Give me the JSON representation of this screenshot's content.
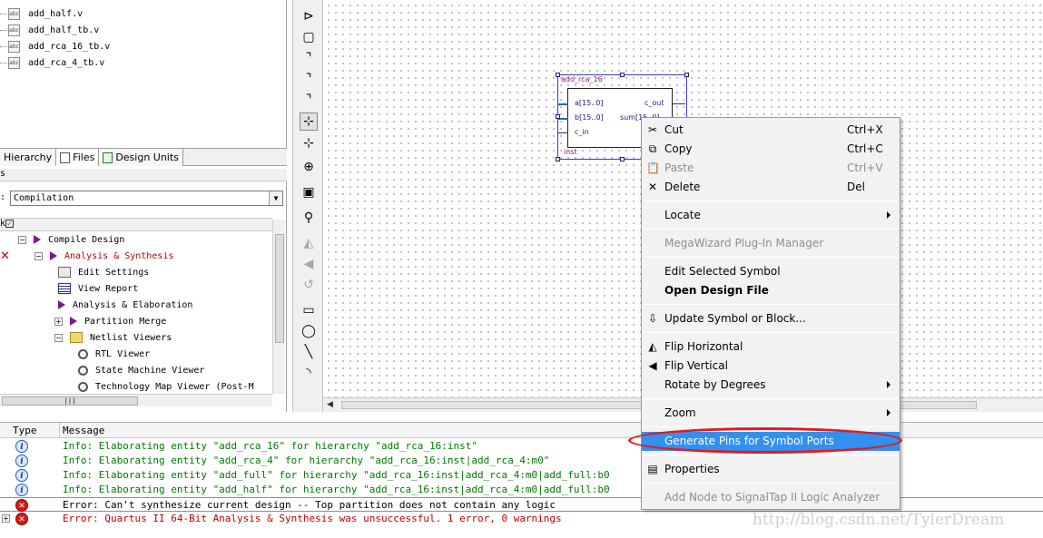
{
  "files": [
    {
      "name": "add_half.v"
    },
    {
      "name": "add_half_tb.v"
    },
    {
      "name": "add_rca_16_tb.v"
    },
    {
      "name": "add_rca_4_tb.v"
    }
  ],
  "file_icon_text": "abc",
  "nav_tabs": [
    {
      "label": "Hierarchy",
      "icon": "hierarchy-icon"
    },
    {
      "label": "Files",
      "icon": "file-icon"
    },
    {
      "label": "Design Units",
      "icon": "design-units-icon"
    }
  ],
  "tasks": {
    "header": "s",
    "flow_label": ":",
    "flow_value": "Compilation",
    "task_col": "k",
    "items": [
      {
        "label": "Compile Design",
        "icon": "play-icon",
        "expander": "−",
        "error": false
      },
      {
        "label": "Analysis & Synthesis",
        "icon": "play-icon",
        "expander": "−",
        "error": true
      },
      {
        "label": "Edit Settings",
        "icon": "settings-icon",
        "expander": "",
        "error": false
      },
      {
        "label": "View Report",
        "icon": "report-icon",
        "expander": "",
        "error": false
      },
      {
        "label": "Analysis & Elaboration",
        "icon": "play-icon",
        "expander": "",
        "error": false
      },
      {
        "label": "Partition Merge",
        "icon": "play-icon",
        "expander": "+",
        "error": false
      },
      {
        "label": "Netlist Viewers",
        "icon": "folder-icon",
        "expander": "−",
        "error": false
      },
      {
        "label": "RTL Viewer",
        "icon": "viewer-icon",
        "expander": "",
        "error": false
      },
      {
        "label": "State Machine Viewer",
        "icon": "viewer-icon",
        "expander": "",
        "error": false
      },
      {
        "label": "Technology Map Viewer (Post-M",
        "icon": "viewer-icon",
        "expander": "",
        "error": false
      }
    ]
  },
  "symbol": {
    "name": "add_rca_16",
    "inst": "inst",
    "ports_in": [
      "a[15..0]",
      "b[15..0]",
      "c_in"
    ],
    "ports_out": [
      "c_out",
      "sum[15..0]"
    ]
  },
  "messages": {
    "col_type": "Type",
    "col_message": "Message",
    "rows": [
      {
        "kind": "info",
        "text": "Info: Elaborating entity \"add_rca_16\" for hierarchy \"add_rca_16:inst\""
      },
      {
        "kind": "info",
        "text": "Info: Elaborating entity \"add_rca_4\" for hierarchy \"add_rca_16:inst|add_rca_4:m0\""
      },
      {
        "kind": "info",
        "text": "Info: Elaborating entity \"add_full\" for hierarchy \"add_rca_16:inst|add_rca_4:m0|add_full:b0"
      },
      {
        "kind": "info",
        "text": "Info: Elaborating entity \"add_half\" for hierarchy \"add_rca_16:inst|add_rca_4:m0|add_full:b0"
      },
      {
        "kind": "error",
        "text": "Error: Can't synthesize current design -- Top partition does not contain any logic"
      },
      {
        "kind": "final",
        "text": "Error: Quartus II 64-Bit Analysis & Synthesis was unsuccessful. 1 error, 0 warnings"
      }
    ],
    "info_glyph": "i",
    "error_glyph": "✕"
  },
  "context_menu": {
    "items": [
      {
        "label": "Cut",
        "shortcut": "Ctrl+X",
        "icon": "scissors-icon",
        "glyph": "✂",
        "state": "normal",
        "submenu": false
      },
      {
        "label": "Copy",
        "shortcut": "Ctrl+C",
        "icon": "copy-icon",
        "glyph": "⧉",
        "state": "normal",
        "submenu": false
      },
      {
        "label": "Paste",
        "shortcut": "Ctrl+V",
        "icon": "paste-icon",
        "glyph": "📋",
        "state": "disabled",
        "submenu": false
      },
      {
        "label": "Delete",
        "shortcut": "Del",
        "icon": "delete-icon",
        "glyph": "✕",
        "state": "normal",
        "submenu": false
      },
      {
        "sep": true
      },
      {
        "label": "Locate",
        "shortcut": "",
        "icon": "",
        "glyph": "",
        "state": "normal",
        "submenu": true
      },
      {
        "sep": true
      },
      {
        "label": "MegaWizard Plug-In Manager",
        "shortcut": "",
        "icon": "",
        "glyph": "",
        "state": "disabled",
        "submenu": false
      },
      {
        "sep": true
      },
      {
        "label": "Edit Selected Symbol",
        "shortcut": "",
        "icon": "",
        "glyph": "",
        "state": "normal",
        "submenu": false
      },
      {
        "label": "Open Design File",
        "shortcut": "",
        "icon": "",
        "glyph": "",
        "state": "bold",
        "submenu": false
      },
      {
        "sep": true
      },
      {
        "label": "Update Symbol or Block...",
        "shortcut": "",
        "icon": "update-symbol-icon",
        "glyph": "⇩",
        "state": "normal",
        "submenu": false
      },
      {
        "sep": true
      },
      {
        "label": "Flip Horizontal",
        "shortcut": "",
        "icon": "flip-horizontal-icon",
        "glyph": "◭",
        "state": "normal",
        "submenu": false
      },
      {
        "label": "Flip Vertical",
        "shortcut": "",
        "icon": "flip-vertical-icon",
        "glyph": "◀",
        "state": "normal",
        "submenu": false
      },
      {
        "label": "Rotate by Degrees",
        "shortcut": "",
        "icon": "",
        "glyph": "",
        "state": "normal",
        "submenu": true
      },
      {
        "sep": true
      },
      {
        "label": "Zoom",
        "shortcut": "",
        "icon": "",
        "glyph": "",
        "state": "normal",
        "submenu": true
      },
      {
        "sep": true
      },
      {
        "label": "Generate Pins for Symbol Ports",
        "shortcut": "",
        "icon": "",
        "glyph": "",
        "state": "highlight",
        "submenu": false
      },
      {
        "sep": true
      },
      {
        "label": "Properties",
        "shortcut": "",
        "icon": "properties-icon",
        "glyph": "▤",
        "state": "normal",
        "submenu": false
      },
      {
        "sep": true
      },
      {
        "label": "Add Node to SignalTap II Logic Analyzer",
        "shortcut": "",
        "icon": "",
        "glyph": "",
        "state": "disabled",
        "submenu": false
      }
    ]
  },
  "toolbar_tools": [
    {
      "icon": "pin-icon",
      "glyph": "⊳",
      "state": "normal"
    },
    {
      "icon": "symbol-icon",
      "glyph": "▢",
      "state": "normal"
    },
    {
      "icon": "orthogonal-node-icon",
      "glyph": "⌝",
      "state": "normal"
    },
    {
      "icon": "orthogonal-bus-icon",
      "glyph": "⌝",
      "state": "normal"
    },
    {
      "icon": "conduit-icon",
      "glyph": "⌝",
      "state": "normal"
    },
    {
      "icon": "rubberbanding-icon",
      "glyph": "⊹",
      "state": "pressed"
    },
    {
      "icon": "partial-line-icon",
      "glyph": "⊹",
      "state": "normal"
    },
    {
      "icon": "zoom-icon",
      "glyph": "⊕",
      "state": "normal"
    },
    {
      "icon": "full-screen-icon",
      "glyph": "▣",
      "state": "normal"
    },
    {
      "icon": "find-icon",
      "glyph": "⚲",
      "state": "normal"
    },
    {
      "icon": "flip-horizontal-icon",
      "glyph": "◭",
      "state": "disabled"
    },
    {
      "icon": "flip-vertical-icon",
      "glyph": "◀",
      "state": "disabled"
    },
    {
      "icon": "rotate-icon",
      "glyph": "↺",
      "state": "disabled"
    },
    {
      "icon": "rectangle-icon",
      "glyph": "▭",
      "state": "normal"
    },
    {
      "icon": "ellipse-icon",
      "glyph": "◯",
      "state": "normal"
    },
    {
      "icon": "line-icon",
      "glyph": "╲",
      "state": "normal"
    },
    {
      "icon": "arc-icon",
      "glyph": "◝",
      "state": "normal"
    }
  ],
  "watermark": "http://blog.csdn.net/TylerDream",
  "colors": {
    "menu_highlight": "#3390f0",
    "error_text": "#c00000",
    "info_text": "#007a00",
    "annotation_ellipse": "#e21a1a"
  }
}
